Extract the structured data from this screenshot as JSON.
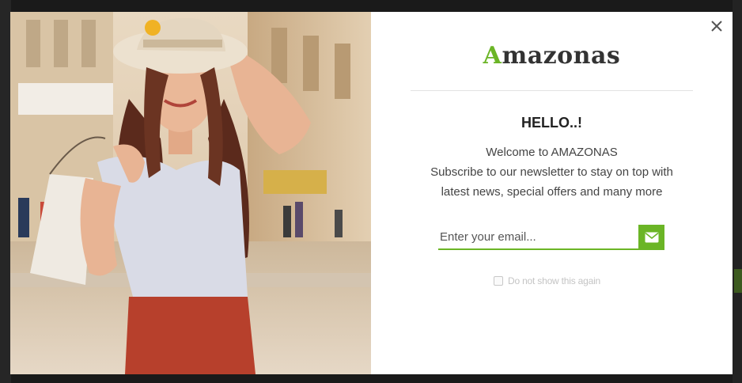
{
  "popup": {
    "logo": {
      "first_letter": "A",
      "rest": "mazonas"
    },
    "title": "HELLO..!",
    "description_lines": [
      "Welcome to AMAZONAS",
      "Subscribe to our newsletter to stay on top with",
      "latest news, special offers and many more"
    ],
    "email_placeholder": "Enter your email...",
    "email_value": "",
    "submit_icon": "envelope-icon",
    "dont_show_label": "Do not show this again",
    "close_icon": "close-icon"
  },
  "colors": {
    "accent": "#6bb526",
    "backdrop": "#1a1a1a",
    "modal_bg": "#ffffff"
  }
}
